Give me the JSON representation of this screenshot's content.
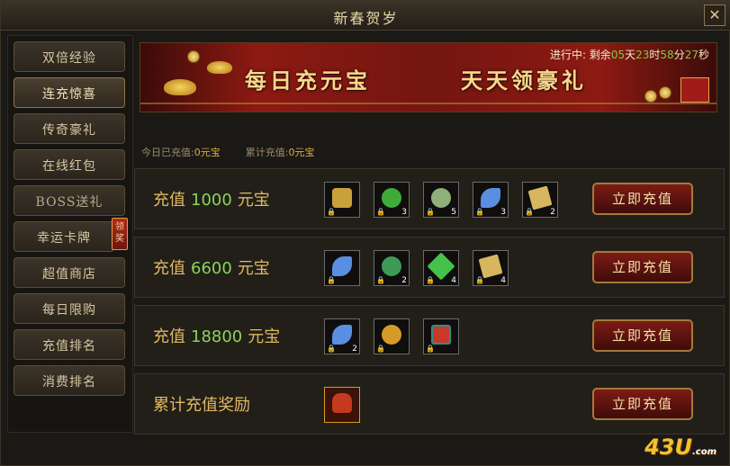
{
  "window": {
    "title": "新春贺岁",
    "close_label": "✕"
  },
  "sidebar": {
    "items": [
      {
        "label": "双倍经验"
      },
      {
        "label": "连充惊喜"
      },
      {
        "label": "传奇豪礼"
      },
      {
        "label": "在线红包"
      },
      {
        "label": "BOSS送礼"
      },
      {
        "label": "幸运卡牌"
      },
      {
        "label": "超值商店"
      },
      {
        "label": "每日限购"
      },
      {
        "label": "充值排名"
      },
      {
        "label": "消费排名"
      }
    ],
    "active_index": 1,
    "badge_label": "领奖"
  },
  "banner": {
    "status_prefix": "进行中: 剩余",
    "days": "05",
    "days_unit": "天",
    "hours": "23",
    "hours_unit": "时",
    "minutes": "58",
    "minutes_unit": "分",
    "seconds": "27",
    "seconds_unit": "秒",
    "slogan_left": "每日充元宝",
    "slogan_right": "天天领豪礼"
  },
  "stats": {
    "today_label": "今日已充值:",
    "today_value": "0元宝",
    "total_label": "累计充值:",
    "total_value": "0元宝"
  },
  "tiers": [
    {
      "prefix": "充值",
      "amount": "1000",
      "suffix": "元宝",
      "button": "立即充值",
      "items": [
        {
          "icon": "treasure-box-icon",
          "count": "",
          "color": "#c9a13a"
        },
        {
          "icon": "green-orb-icon",
          "count": "3",
          "color": "#3faa3a"
        },
        {
          "icon": "jade-orb-icon",
          "count": "5",
          "color": "#8fb07a"
        },
        {
          "icon": "wing-icon",
          "count": "3",
          "color": "#5a8ee0"
        },
        {
          "icon": "scroll-icon",
          "count": "2",
          "color": "#d8b660"
        }
      ]
    },
    {
      "prefix": "充值",
      "amount": "6600",
      "suffix": "元宝",
      "button": "立即充值",
      "items": [
        {
          "icon": "wing-icon",
          "count": "",
          "color": "#5a8ee0"
        },
        {
          "icon": "crystal-ball-icon",
          "count": "2",
          "color": "#3d9a55"
        },
        {
          "icon": "green-crystal-icon",
          "count": "4",
          "color": "#44c24a"
        },
        {
          "icon": "scroll-icon",
          "count": "4",
          "color": "#d8b660"
        }
      ]
    },
    {
      "prefix": "充值",
      "amount": "18800",
      "suffix": "元宝",
      "button": "立即充值",
      "items": [
        {
          "icon": "wing-icon",
          "count": "2",
          "color": "#5a8ee0"
        },
        {
          "icon": "gold-orb-icon",
          "count": "",
          "color": "#d69a2a"
        },
        {
          "icon": "red-banner-icon",
          "count": "",
          "color": "#c8392c"
        }
      ]
    },
    {
      "prefix": "累计充值奖励",
      "amount": "",
      "suffix": "",
      "button": "立即充值",
      "items": [
        {
          "icon": "gift-bag-icon",
          "count": "",
          "color": "#c43a1e"
        }
      ]
    }
  ],
  "watermark": {
    "text": "43U",
    "suffix": ".com"
  }
}
